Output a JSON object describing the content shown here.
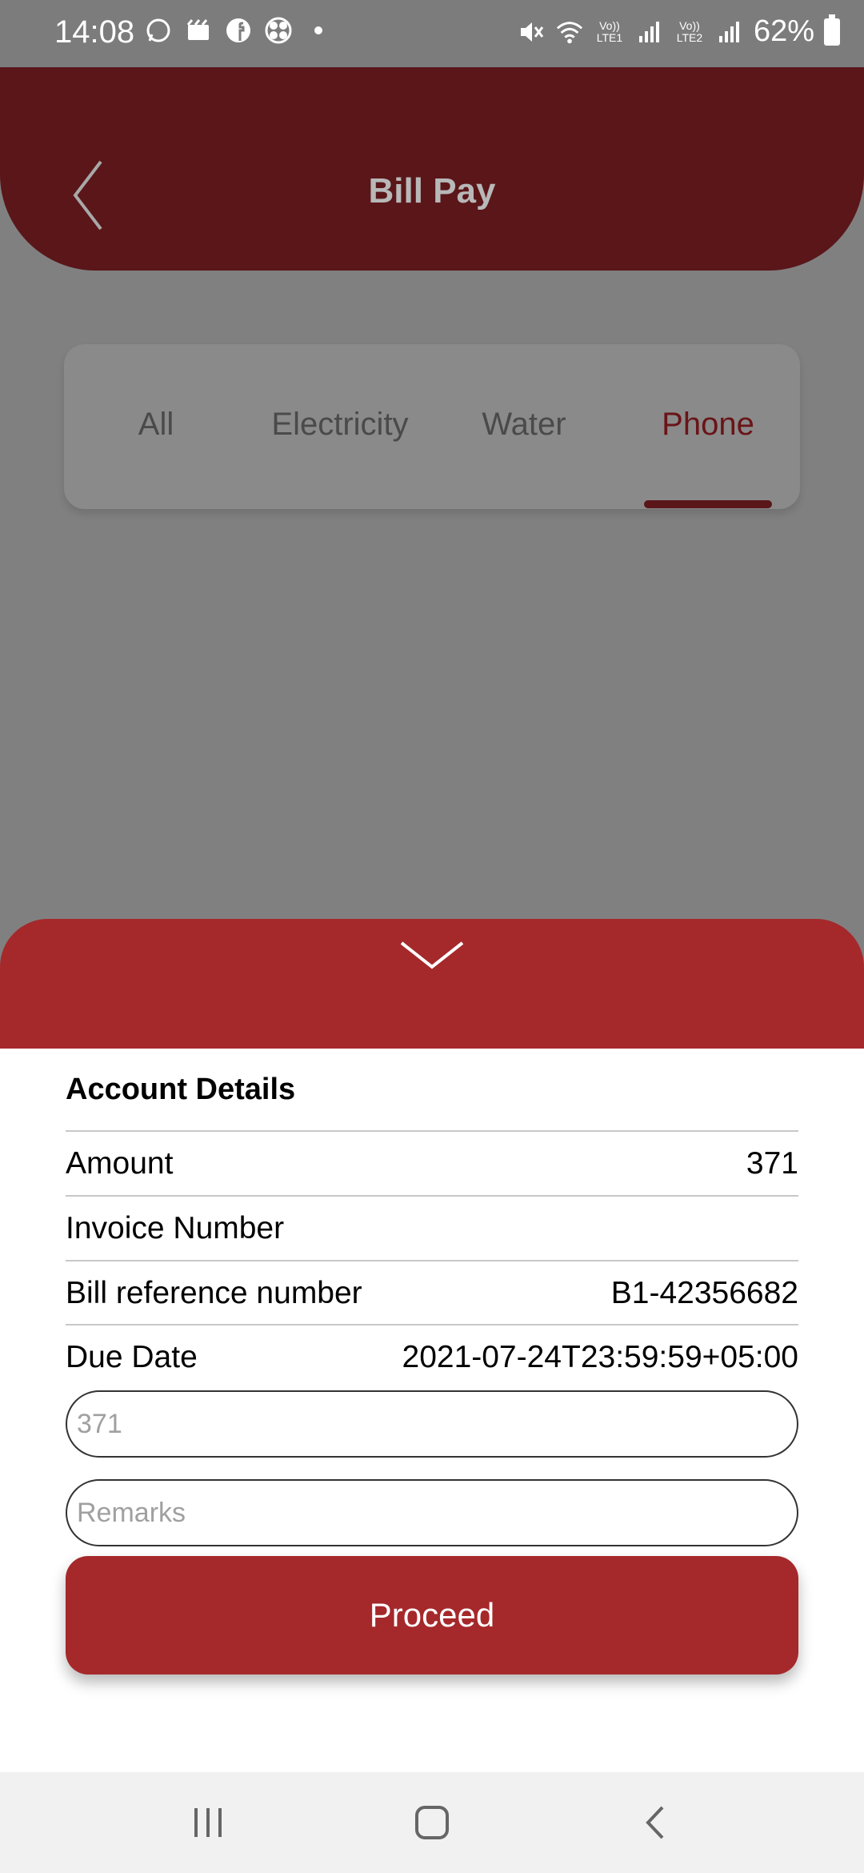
{
  "status_bar": {
    "time": "14:08",
    "battery": "62%",
    "lte1": "Vo)) LTE1",
    "lte2": "Vo)) LTE2",
    "left_icons": [
      "whatsapp-icon",
      "clapper-icon",
      "facebook-icon",
      "fan-icon",
      "dot-icon"
    ],
    "right_icons": [
      "mute-icon",
      "wifi-icon",
      "signal-icon",
      "signal-icon",
      "battery-icon"
    ]
  },
  "header": {
    "title": "Bill Pay",
    "back_icon": "chevron-left-icon"
  },
  "tabs": [
    {
      "label": "All",
      "active": false
    },
    {
      "label": "Electricity",
      "active": false
    },
    {
      "label": "Water",
      "active": false
    },
    {
      "label": "Phone",
      "active": true
    }
  ],
  "sheet": {
    "collapse_icon": "chevron-down-icon",
    "section_title": "Account Details",
    "rows": [
      {
        "label": "Amount",
        "value": "371"
      },
      {
        "label": "Invoice Number",
        "value": ""
      },
      {
        "label": "Bill reference number",
        "value": "B1-42356682"
      },
      {
        "label": "Due Date",
        "value": "2021-07-24T23:59:59+05:00"
      }
    ],
    "amount_input_placeholder": "371",
    "remarks_input_placeholder": "Remarks",
    "proceed_label": "Proceed"
  },
  "nav_bar": {
    "recents_icon": "recents-icon",
    "home_icon": "home-icon",
    "back_icon": "back-icon"
  },
  "colors": {
    "header": "#5a1619",
    "accent": "#a5282b",
    "overlay": "#808080"
  }
}
